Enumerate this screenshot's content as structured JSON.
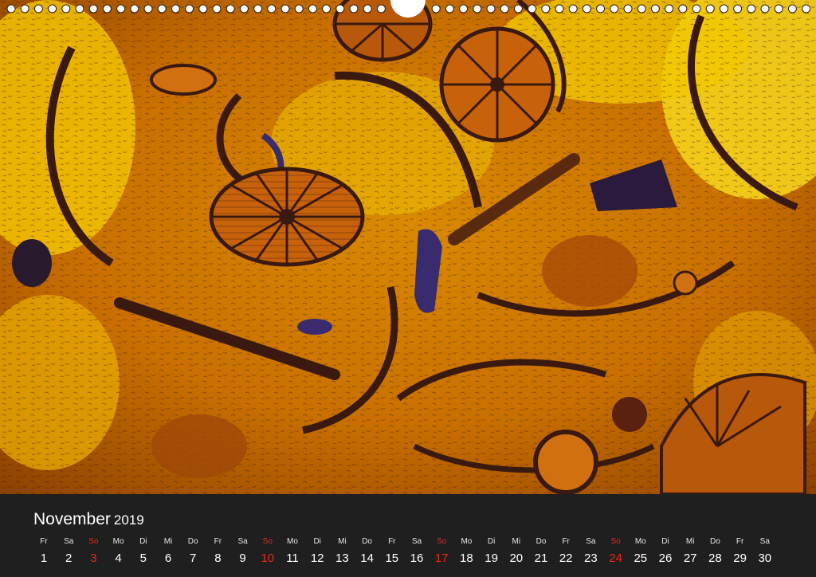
{
  "calendar": {
    "month": "November",
    "year": "2019",
    "sunday_color": "#e32b1c",
    "days": [
      {
        "weekday": "Fr",
        "day": "1"
      },
      {
        "weekday": "Sa",
        "day": "2"
      },
      {
        "weekday": "So",
        "day": "3",
        "sunday": true
      },
      {
        "weekday": "Mo",
        "day": "4"
      },
      {
        "weekday": "Di",
        "day": "5"
      },
      {
        "weekday": "Mi",
        "day": "6"
      },
      {
        "weekday": "Do",
        "day": "7"
      },
      {
        "weekday": "Fr",
        "day": "8"
      },
      {
        "weekday": "Sa",
        "day": "9"
      },
      {
        "weekday": "So",
        "day": "10",
        "sunday": true
      },
      {
        "weekday": "Mo",
        "day": "11"
      },
      {
        "weekday": "Di",
        "day": "12"
      },
      {
        "weekday": "Mi",
        "day": "13"
      },
      {
        "weekday": "Do",
        "day": "14"
      },
      {
        "weekday": "Fr",
        "day": "15"
      },
      {
        "weekday": "Sa",
        "day": "16"
      },
      {
        "weekday": "So",
        "day": "17",
        "sunday": true
      },
      {
        "weekday": "Mo",
        "day": "18"
      },
      {
        "weekday": "Di",
        "day": "19"
      },
      {
        "weekday": "Mi",
        "day": "20"
      },
      {
        "weekday": "Do",
        "day": "21"
      },
      {
        "weekday": "Fr",
        "day": "22"
      },
      {
        "weekday": "Sa",
        "day": "23"
      },
      {
        "weekday": "So",
        "day": "24",
        "sunday": true
      },
      {
        "weekday": "Mo",
        "day": "25"
      },
      {
        "weekday": "Di",
        "day": "26"
      },
      {
        "weekday": "Mi",
        "day": "27"
      },
      {
        "weekday": "Do",
        "day": "28"
      },
      {
        "weekday": "Fr",
        "day": "29"
      },
      {
        "weekday": "Sa",
        "day": "30"
      }
    ]
  },
  "artwork": {
    "subject": "golden microfossil thin-section artwork",
    "colors": [
      "#f2c200",
      "#d98a00",
      "#8a3a00",
      "#3a1a10",
      "#3a2a6e"
    ]
  }
}
